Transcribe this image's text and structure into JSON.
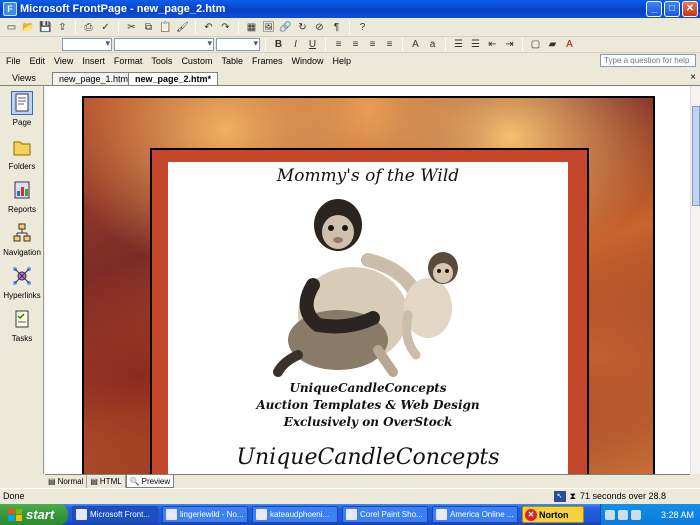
{
  "window": {
    "title": "Microsoft FrontPage - new_page_2.htm",
    "minimize": "_",
    "maximize": "□",
    "close": "✕"
  },
  "menu": [
    "File",
    "Edit",
    "View",
    "Insert",
    "Format",
    "Tools",
    "Custom",
    "Table",
    "Frames",
    "Window",
    "Help"
  ],
  "help_placeholder": "Type a question for help",
  "views_label": "Views",
  "tabs": [
    {
      "label": "new_page_1.htm*"
    },
    {
      "label": "new_page_2.htm*"
    }
  ],
  "views": [
    {
      "label": "Page"
    },
    {
      "label": "Folders"
    },
    {
      "label": "Reports"
    },
    {
      "label": "Navigation"
    },
    {
      "label": "Hyperlinks"
    },
    {
      "label": "Tasks"
    }
  ],
  "page": {
    "heading": "Mommy's of the Wild",
    "credit_line1": "UniqueCandleConcepts",
    "credit_line2": "Auction Templates & Web Design",
    "credit_line3": "Exclusively on OverStock",
    "big_title": "UniqueCandleConcepts"
  },
  "modes": [
    "Normal",
    "HTML",
    "Preview"
  ],
  "status": {
    "left": "Done",
    "right": "71 seconds over 28.8"
  },
  "taskbar": {
    "start": "start",
    "tasks": [
      "Microsoft Front...",
      "lingeriewild - No...",
      "kateaudphoeni...",
      "Corel Paint Sho...",
      "America Online ..."
    ],
    "norton": "Norton",
    "clock": "3:28 AM"
  },
  "colors": {
    "frame_red": "#c4472c",
    "xp_blue": "#245edb",
    "start_green": "#35963a"
  }
}
